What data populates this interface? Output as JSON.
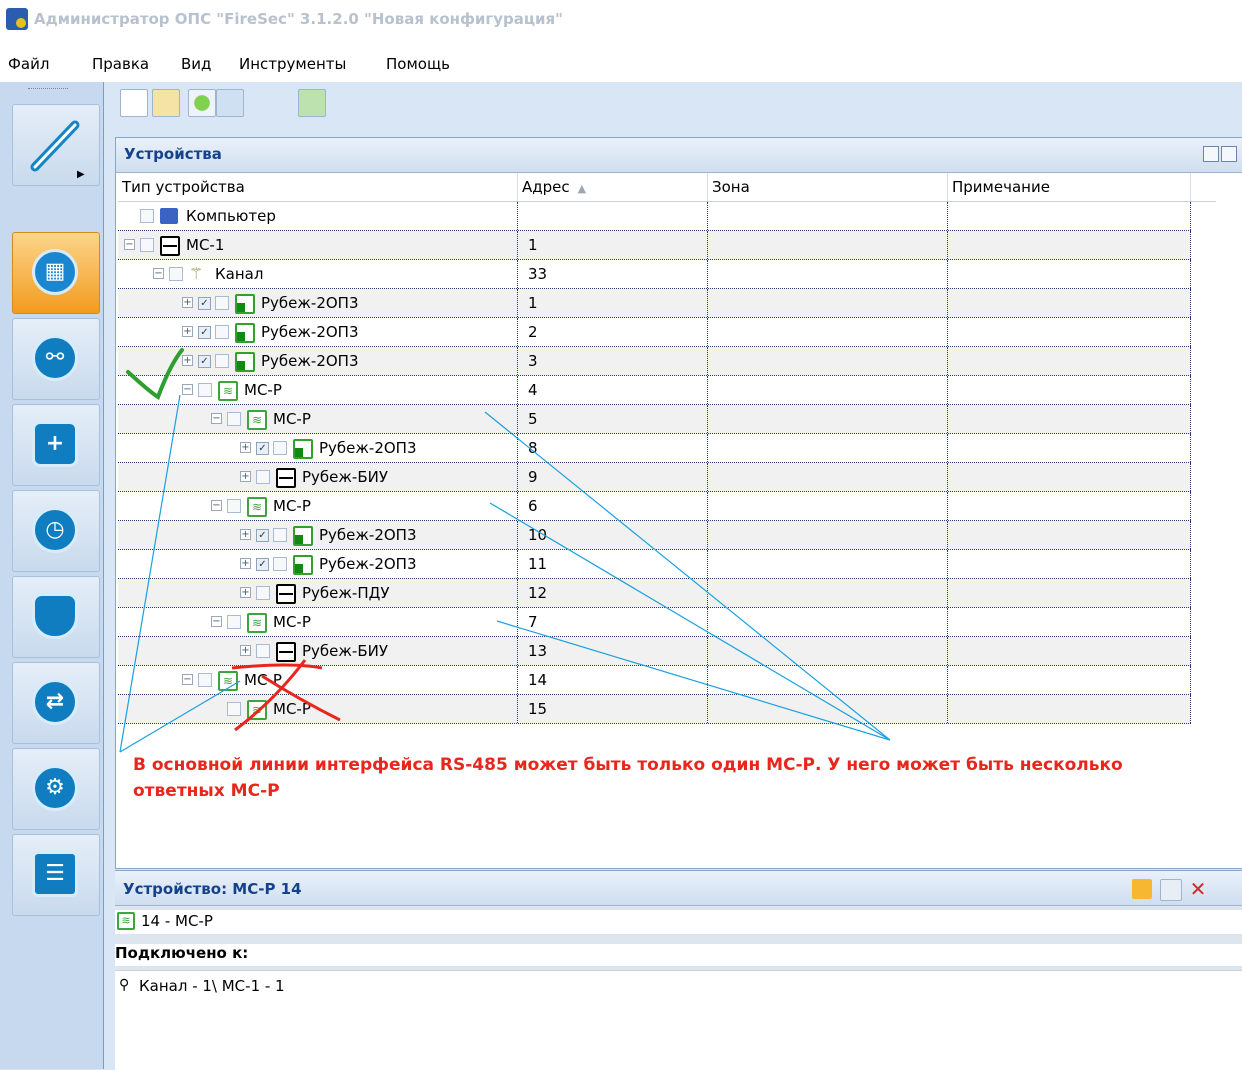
{
  "window": {
    "title": "Администратор ОПС \"FireSec\" 3.1.2.0  \"Новая конфигурация\""
  },
  "menu": [
    "Файл",
    "Правка",
    "Вид",
    "Инструменты",
    "Помощь"
  ],
  "devices_panel": {
    "title": "Устройства",
    "columns": {
      "type": "Тип устройства",
      "address": "Адрес",
      "zone": "Зона",
      "note": "Примечание"
    },
    "rows": [
      {
        "name": "Компьютер",
        "address": "",
        "icon": "computer-icon"
      },
      {
        "name": "МС-1",
        "address": "1",
        "icon": "module-icon"
      },
      {
        "name": "Канал",
        "address": "33",
        "icon": "channel-icon"
      },
      {
        "name": "Рубеж-2ОП3",
        "address": "1",
        "icon": "detector-icon"
      },
      {
        "name": "Рубеж-2ОП3",
        "address": "2",
        "icon": "detector-icon"
      },
      {
        "name": "Рубеж-2ОП3",
        "address": "3",
        "icon": "detector-icon"
      },
      {
        "name": "МС-Р",
        "address": "4",
        "icon": "wireless-icon"
      },
      {
        "name": "МС-Р",
        "address": "5",
        "icon": "wireless-icon"
      },
      {
        "name": "Рубеж-2ОП3",
        "address": "8",
        "icon": "detector-icon"
      },
      {
        "name": "Рубеж-БИУ",
        "address": "9",
        "icon": "module-icon"
      },
      {
        "name": "МС-Р",
        "address": "6",
        "icon": "wireless-icon"
      },
      {
        "name": "Рубеж-2ОП3",
        "address": "10",
        "icon": "detector-icon"
      },
      {
        "name": "Рубеж-2ОП3",
        "address": "11",
        "icon": "detector-icon"
      },
      {
        "name": "Рубеж-ПДУ",
        "address": "12",
        "icon": "module-icon"
      },
      {
        "name": "МС-Р",
        "address": "7",
        "icon": "wireless-icon"
      },
      {
        "name": "Рубеж-БИУ",
        "address": "13",
        "icon": "module-icon"
      },
      {
        "name": "МС-Р",
        "address": "14",
        "icon": "wireless-icon"
      },
      {
        "name": "МС-Р",
        "address": "15",
        "icon": "wireless-icon"
      }
    ]
  },
  "annotation": {
    "line1": "В основной линии интерфейса RS-485 может быть только один МС-Р.   У него может быть несколько",
    "line2": "ответных МС-Р"
  },
  "device_panel": {
    "title": "Устройство: МС-Р 14",
    "device_line": "14 - МС-Р",
    "connected_label": "Подключено к:",
    "connected_value": "Канал - 1\\ МС-1 - 1"
  },
  "colors": {
    "annotation_red": "#e8261c",
    "annotation_blue": "#1aa0e0",
    "check_green": "#2e9e2e",
    "active_nav": "#f39b1f"
  }
}
